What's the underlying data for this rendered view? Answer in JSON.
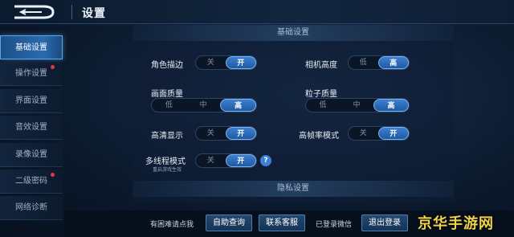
{
  "header": {
    "title": "设置"
  },
  "sidebar": {
    "items": [
      {
        "label": "基础设置",
        "active": true,
        "badge": false
      },
      {
        "label": "操作设置",
        "active": false,
        "badge": true
      },
      {
        "label": "界面设置",
        "active": false,
        "badge": false
      },
      {
        "label": "音效设置",
        "active": false,
        "badge": false
      },
      {
        "label": "录像设置",
        "active": false,
        "badge": false
      },
      {
        "label": "二级密码",
        "active": false,
        "badge": true
      },
      {
        "label": "网络诊断",
        "active": false,
        "badge": false
      }
    ]
  },
  "sections": {
    "basic": "基础设置",
    "privacy": "隐私设置"
  },
  "settings": {
    "outline": {
      "label": "角色描边",
      "options": [
        "关",
        "开"
      ],
      "selected": "开"
    },
    "camera_height": {
      "label": "相机高度",
      "options": [
        "低",
        "高"
      ],
      "selected": "高"
    },
    "quality": {
      "label": "画面质量",
      "options": [
        "低",
        "中",
        "高"
      ],
      "selected": "高"
    },
    "particle": {
      "label": "粒子质量",
      "options": [
        "低",
        "中",
        "高"
      ],
      "selected": "高"
    },
    "hd": {
      "label": "高清显示",
      "options": [
        "关",
        "开"
      ],
      "selected": "开"
    },
    "high_fps": {
      "label": "高帧率模式",
      "options": [
        "关",
        "开"
      ],
      "selected": "开"
    },
    "multithread": {
      "label": "多线程模式",
      "hint": "重启游戏生效",
      "options": [
        "关",
        "开"
      ],
      "selected": "开"
    }
  },
  "footer": {
    "help_text": "有困难请点我",
    "self_service": "自助查询",
    "contact": "联系客服",
    "wechat_status": "已登录微信",
    "logout": "退出登录"
  },
  "watermark": "京华手游网",
  "colors": {
    "accent": "#2a6bb0",
    "badge": "#e03a3a",
    "watermark": "#f1d34a"
  }
}
